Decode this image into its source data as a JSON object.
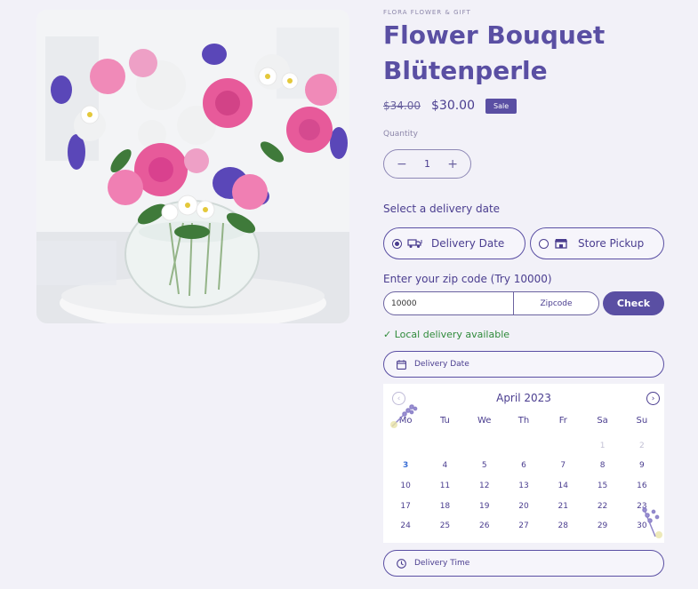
{
  "product": {
    "vendor": "FLORA FLOWER & GIFT",
    "title": "Flower Bouquet Blütenperle",
    "price_old": "$34.00",
    "price_new": "$30.00",
    "sale_badge": "Sale"
  },
  "quantity": {
    "label": "Quantity",
    "value": "1",
    "minus": "−",
    "plus": "+"
  },
  "delivery": {
    "label": "Select a delivery date",
    "options": [
      {
        "label": "Delivery Date",
        "selected": true
      },
      {
        "label": "Store Pickup",
        "selected": false
      }
    ]
  },
  "zip": {
    "label": "Enter your zip code (Try 10000)",
    "value": "10000",
    "suffix": "Zipcode",
    "check_label": "Check",
    "availability": "✓ Local delivery available"
  },
  "date_field": {
    "placeholder": "Delivery Date"
  },
  "time_field": {
    "placeholder": "Delivery Time"
  },
  "calendar": {
    "month": "April 2023",
    "prev": "‹",
    "next": "›",
    "weekdays": [
      "Mo",
      "Tu",
      "We",
      "Th",
      "Fr",
      "Sa",
      "Su"
    ],
    "weeks": [
      [
        {
          "d": "",
          "s": ""
        },
        {
          "d": "",
          "s": ""
        },
        {
          "d": "",
          "s": ""
        },
        {
          "d": "",
          "s": ""
        },
        {
          "d": "",
          "s": ""
        },
        {
          "d": "1",
          "s": "muted"
        },
        {
          "d": "2",
          "s": "muted"
        }
      ],
      [
        {
          "d": "3",
          "s": "today"
        },
        {
          "d": "4",
          "s": ""
        },
        {
          "d": "5",
          "s": ""
        },
        {
          "d": "6",
          "s": ""
        },
        {
          "d": "7",
          "s": ""
        },
        {
          "d": "8",
          "s": ""
        },
        {
          "d": "9",
          "s": ""
        }
      ],
      [
        {
          "d": "10",
          "s": ""
        },
        {
          "d": "11",
          "s": ""
        },
        {
          "d": "12",
          "s": ""
        },
        {
          "d": "13",
          "s": ""
        },
        {
          "d": "14",
          "s": ""
        },
        {
          "d": "15",
          "s": ""
        },
        {
          "d": "16",
          "s": ""
        }
      ],
      [
        {
          "d": "17",
          "s": ""
        },
        {
          "d": "18",
          "s": ""
        },
        {
          "d": "19",
          "s": ""
        },
        {
          "d": "20",
          "s": ""
        },
        {
          "d": "21",
          "s": ""
        },
        {
          "d": "22",
          "s": ""
        },
        {
          "d": "23",
          "s": ""
        }
      ],
      [
        {
          "d": "24",
          "s": ""
        },
        {
          "d": "25",
          "s": ""
        },
        {
          "d": "26",
          "s": ""
        },
        {
          "d": "27",
          "s": ""
        },
        {
          "d": "28",
          "s": ""
        },
        {
          "d": "29",
          "s": ""
        },
        {
          "d": "30",
          "s": ""
        }
      ]
    ]
  },
  "colors": {
    "accent": "#5a4fa3",
    "text": "#4a3d8f",
    "success": "#2f8a3a",
    "background": "#f2f1f8"
  },
  "icons": {
    "delivery_option": "truck-icon",
    "pickup_option": "store-icon",
    "date_field": "calendar-icon",
    "time_field": "clock-icon"
  }
}
